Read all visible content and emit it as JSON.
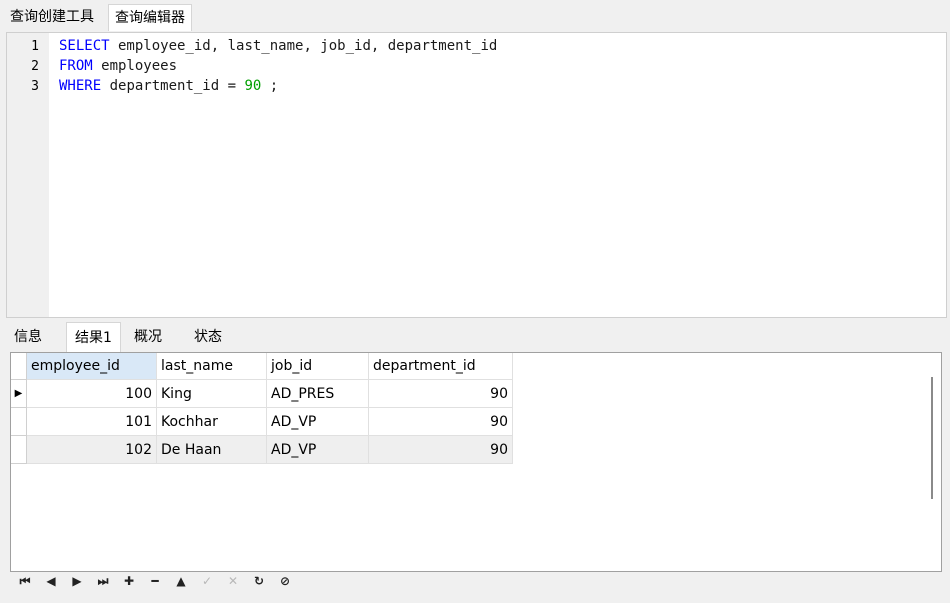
{
  "top_tabs": [
    "查询创建工具",
    "查询编辑器"
  ],
  "editor": {
    "lines": [
      {
        "num": "1",
        "kw": "SELECT",
        "rest": " employee_id, last_name, job_id, department_id"
      },
      {
        "num": "2",
        "kw": "FROM",
        "rest": " employees"
      },
      {
        "num": "3",
        "kw": "WHERE",
        "rest": " department_id = ",
        "number": "90",
        "tail": " ;"
      }
    ]
  },
  "result_tabs": [
    "信息",
    "结果1",
    "概况",
    "状态"
  ],
  "grid": {
    "columns": [
      "employee_id",
      "last_name",
      "job_id",
      "department_id"
    ],
    "rows": [
      [
        "100",
        "King",
        "AD_PRES",
        "90"
      ],
      [
        "101",
        "Kochhar",
        "AD_VP",
        "90"
      ],
      [
        "102",
        "De Haan",
        "AD_VP",
        "90"
      ]
    ]
  },
  "toolbar": {
    "icons": [
      "first-record-icon",
      "previous-record-icon",
      "next-record-icon",
      "last-record-icon",
      "add-record-icon",
      "delete-record-icon",
      "move-up-icon",
      "apply-changes-icon",
      "discard-changes-icon",
      "refresh-icon",
      "stop-icon"
    ],
    "glyphs": [
      "⏮",
      "◀",
      "▶",
      "⏭",
      "✚",
      "━",
      "▲",
      "✓",
      "✕",
      "↻",
      "⊘"
    ]
  }
}
